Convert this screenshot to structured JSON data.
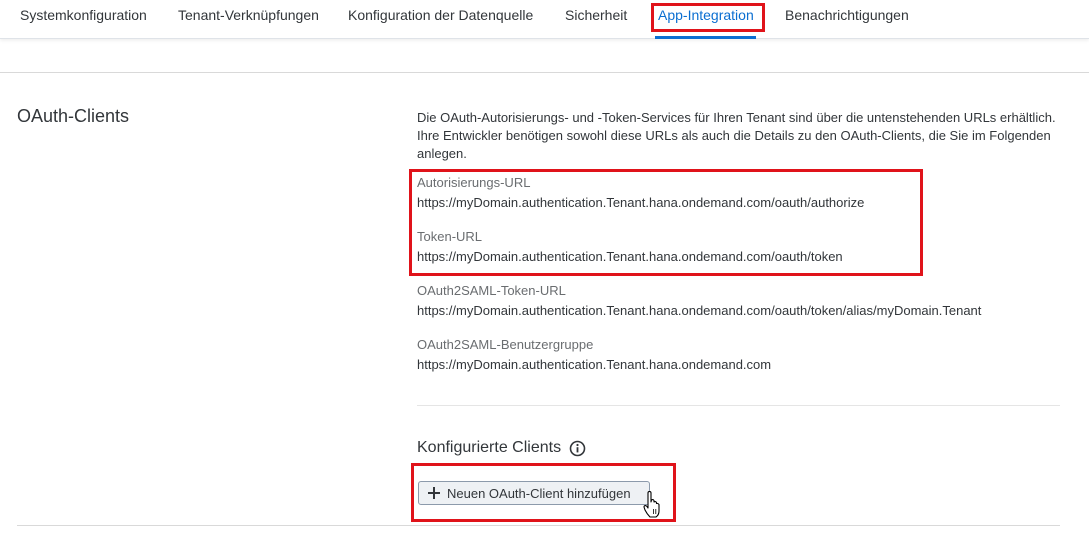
{
  "tabs": [
    {
      "label": "Systemkonfiguration"
    },
    {
      "label": "Tenant-Verknüpfungen"
    },
    {
      "label": "Konfiguration der Datenquelle"
    },
    {
      "label": "Sicherheit"
    },
    {
      "label": "App-Integration",
      "selected": true
    },
    {
      "label": "Benachrichtigungen"
    }
  ],
  "section": {
    "title": "OAuth-Clients",
    "description": "Die OAuth-Autorisierungs- und -Token-Services für Ihren Tenant sind über die untenstehenden URLs erhältlich. Ihre Entwickler benötigen sowohl diese URLs als auch die Details zu den OAuth-Clients, die Sie im Folgenden anlegen.",
    "fields": [
      {
        "label": "Autorisierungs-URL",
        "value": "https://myDomain.authentication.Tenant.hana.ondemand.com/oauth/authorize"
      },
      {
        "label": "Token-URL",
        "value": "https://myDomain.authentication.Tenant.hana.ondemand.com/oauth/token"
      },
      {
        "label": "OAuth2SAML-Token-URL",
        "value": "https://myDomain.authentication.Tenant.hana.ondemand.com/oauth/token/alias/myDomain.Tenant"
      },
      {
        "label": "OAuth2SAML-Benutzergruppe",
        "value": "https://myDomain.authentication.Tenant.hana.ondemand.com"
      }
    ],
    "configured_clients_title": "Konfigurierte Clients",
    "add_client_button": "Neuen OAuth-Client hinzufügen"
  },
  "colors": {
    "accent": "#0a6ed1",
    "highlight": "#e0131a",
    "text": "#32363a",
    "label": "#6a6d70"
  },
  "icons": [
    "info-icon",
    "plus-icon",
    "hand-cursor-icon"
  ]
}
